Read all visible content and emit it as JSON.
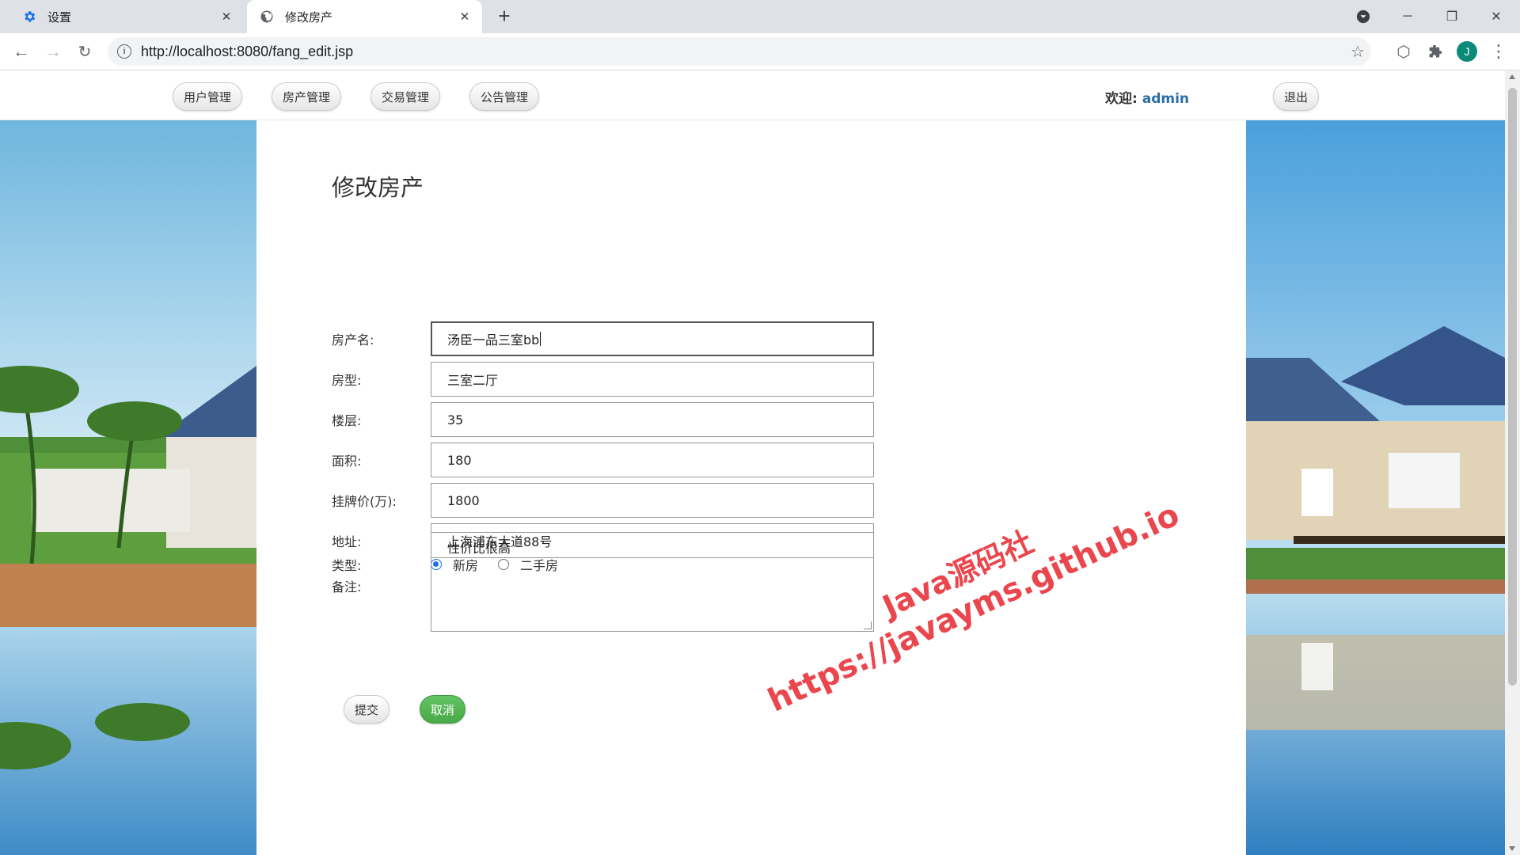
{
  "browser": {
    "tabs": [
      {
        "title": "设置",
        "icon": "gear-icon",
        "active": false
      },
      {
        "title": "修改房产",
        "icon": "globe-icon",
        "active": true
      }
    ],
    "url": "http://localhost:8080/fang_edit.jsp",
    "profile_initial": "J"
  },
  "nav": {
    "items": [
      "用户管理",
      "房产管理",
      "交易管理",
      "公告管理"
    ],
    "welcome_label": "欢迎:",
    "username": "admin",
    "logout": "退出"
  },
  "form": {
    "title": "修改房产",
    "fields": [
      {
        "label": "房产名:",
        "value": "汤臣一品三室bb"
      },
      {
        "label": "房型:",
        "value": "三室二厅"
      },
      {
        "label": "楼层:",
        "value": "35"
      },
      {
        "label": "面积:",
        "value": "180"
      },
      {
        "label": "挂牌价(万):",
        "value": "1800"
      },
      {
        "label": "地址:",
        "value": "上海浦东大道88号"
      }
    ],
    "type": {
      "label": "类型:",
      "options": [
        "新房",
        "二手房"
      ],
      "selected": "新房"
    },
    "remark": {
      "label": "备注:",
      "value": "性价比很高"
    },
    "submit": "提交",
    "cancel": "取消"
  },
  "watermark": {
    "line1": "Java源码社",
    "line2": "https://javayms.github.io"
  },
  "colors": {
    "accent": "#1a73e8",
    "cancel": "#4aa94a",
    "username": "#2a6ea6",
    "watermark": "#e8333a"
  }
}
